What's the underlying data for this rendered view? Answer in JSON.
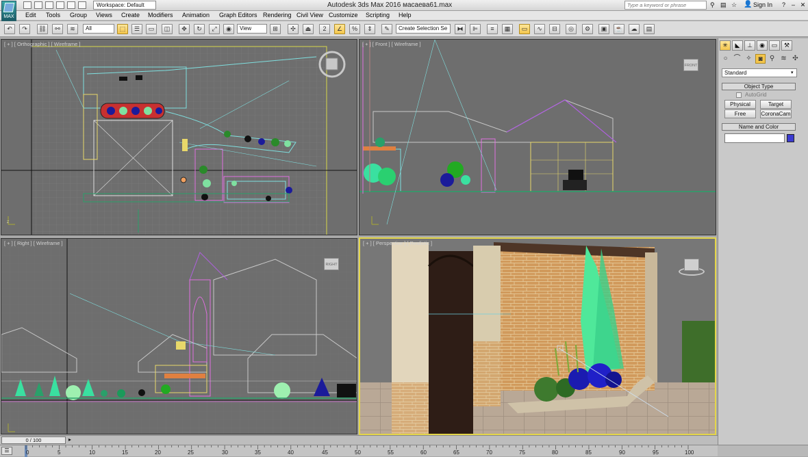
{
  "title_bar": {
    "app_title": "Autodesk 3ds Max 2016      масаева61.max",
    "workspace": "Workspace: Default",
    "search_placeholder": "Type a keyword or phrase",
    "sign_in": "Sign In",
    "logo_text": "MAX"
  },
  "menu": [
    "Edit",
    "Tools",
    "Group",
    "Views",
    "Create",
    "Modifiers",
    "Animation",
    "Graph Editors",
    "Rendering",
    "Civil View",
    "Customize",
    "Scripting",
    "Help"
  ],
  "toolbar": {
    "selection_filter": "All",
    "ref_coord": "View",
    "selection_set_placeholder": "Create Selection Se"
  },
  "viewports": {
    "top_left": {
      "label": "[ + ] [ Orthographic ] [ Wireframe ]"
    },
    "top_right": {
      "label": "[ + ] [ Front ] [ Wireframe ]",
      "cube_label": "FRONT"
    },
    "bottom_left": {
      "label": "[ + ] [ Right ] [ Wireframe ]",
      "cube_label": "RIGHT"
    },
    "bottom_right": {
      "label": "[ + ] [ Perspective ] [ Realistic ]"
    }
  },
  "command_panel": {
    "category": "Standard",
    "object_type_header": "Object Type",
    "autogrid": "AutoGrid",
    "buttons": [
      "Physical",
      "Target",
      "Free",
      "CoronaCam"
    ],
    "name_color_header": "Name and Color",
    "color": "#3b3bd0"
  },
  "timeline": {
    "frame_indicator": "0 / 100",
    "ticks": [
      "0",
      "5",
      "10",
      "15",
      "20",
      "25",
      "30",
      "35",
      "40",
      "45",
      "50",
      "55",
      "60",
      "65",
      "70",
      "75",
      "80",
      "85",
      "90",
      "95",
      "100"
    ]
  }
}
